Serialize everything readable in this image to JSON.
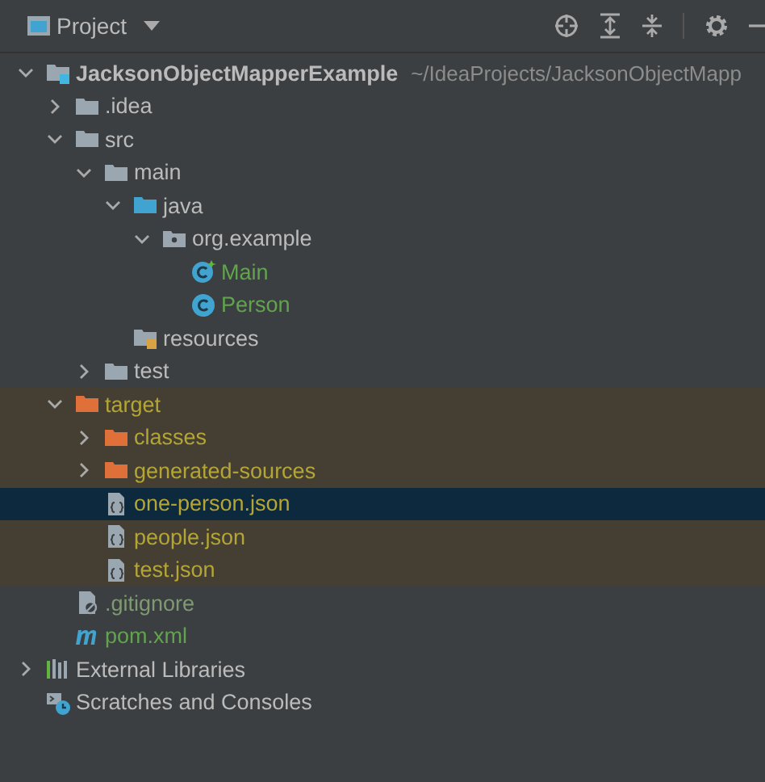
{
  "panel": {
    "title": "Project"
  },
  "tree": [
    {
      "kind": "module",
      "label": "JacksonObjectMapperExample",
      "path": "~/IdeaProjects/JacksonObjectMapp",
      "color": "#bbbbbb",
      "excluded": false,
      "selected": false,
      "expanded": true,
      "children": [
        {
          "kind": "folder",
          "label": ".idea",
          "color": "#bbbbbb",
          "excluded": false,
          "selected": false,
          "expanded": false
        },
        {
          "kind": "folder",
          "label": "src",
          "color": "#bbbbbb",
          "excluded": false,
          "selected": false,
          "expanded": true,
          "children": [
            {
              "kind": "folder",
              "label": "main",
              "color": "#bbbbbb",
              "excluded": false,
              "selected": false,
              "expanded": true,
              "children": [
                {
                  "kind": "source",
                  "label": "java",
                  "color": "#bbbbbb",
                  "excluded": false,
                  "selected": false,
                  "expanded": true,
                  "children": [
                    {
                      "kind": "package",
                      "label": "org.example",
                      "color": "#bbbbbb",
                      "excluded": false,
                      "selected": false,
                      "expanded": true,
                      "children": [
                        {
                          "kind": "main-class",
                          "label": "Main",
                          "color": "#62a44e",
                          "excluded": false,
                          "selected": false
                        },
                        {
                          "kind": "class",
                          "label": "Person",
                          "color": "#62a44e",
                          "excluded": false,
                          "selected": false
                        }
                      ]
                    }
                  ]
                },
                {
                  "kind": "resources",
                  "label": "resources",
                  "color": "#bbbbbb",
                  "excluded": false,
                  "selected": false
                }
              ]
            },
            {
              "kind": "folder",
              "label": "test",
              "color": "#bbbbbb",
              "excluded": false,
              "selected": false,
              "expanded": false
            }
          ]
        },
        {
          "kind": "excluded",
          "label": "target",
          "color": "#b3a536",
          "excluded": true,
          "selected": false,
          "expanded": true,
          "children": [
            {
              "kind": "excluded",
              "label": "classes",
              "color": "#b3a536",
              "excluded": true,
              "selected": false,
              "expanded": false
            },
            {
              "kind": "excluded",
              "label": "generated-sources",
              "color": "#b3a536",
              "excluded": true,
              "selected": false,
              "expanded": false
            },
            {
              "kind": "json",
              "label": "one-person.json",
              "color": "#b3a536",
              "selected": true
            },
            {
              "kind": "json",
              "label": "people.json",
              "color": "#b3a536",
              "excluded": true,
              "selected": false
            },
            {
              "kind": "json",
              "label": "test.json",
              "color": "#b3a536",
              "excluded": true,
              "selected": false
            }
          ]
        },
        {
          "kind": "gitignore",
          "label": ".gitignore",
          "color": "#7f9a72",
          "excluded": false,
          "selected": false
        },
        {
          "kind": "maven",
          "label": "pom.xml",
          "color": "#62a44e",
          "excluded": false,
          "selected": false
        }
      ]
    },
    {
      "kind": "libraries",
      "label": "External Libraries",
      "color": "#bbbbbb",
      "excluded": false,
      "selected": false,
      "expanded": false
    },
    {
      "kind": "scratches",
      "label": "Scratches and Consoles",
      "color": "#bbbbbb",
      "excluded": false,
      "selected": false
    }
  ]
}
